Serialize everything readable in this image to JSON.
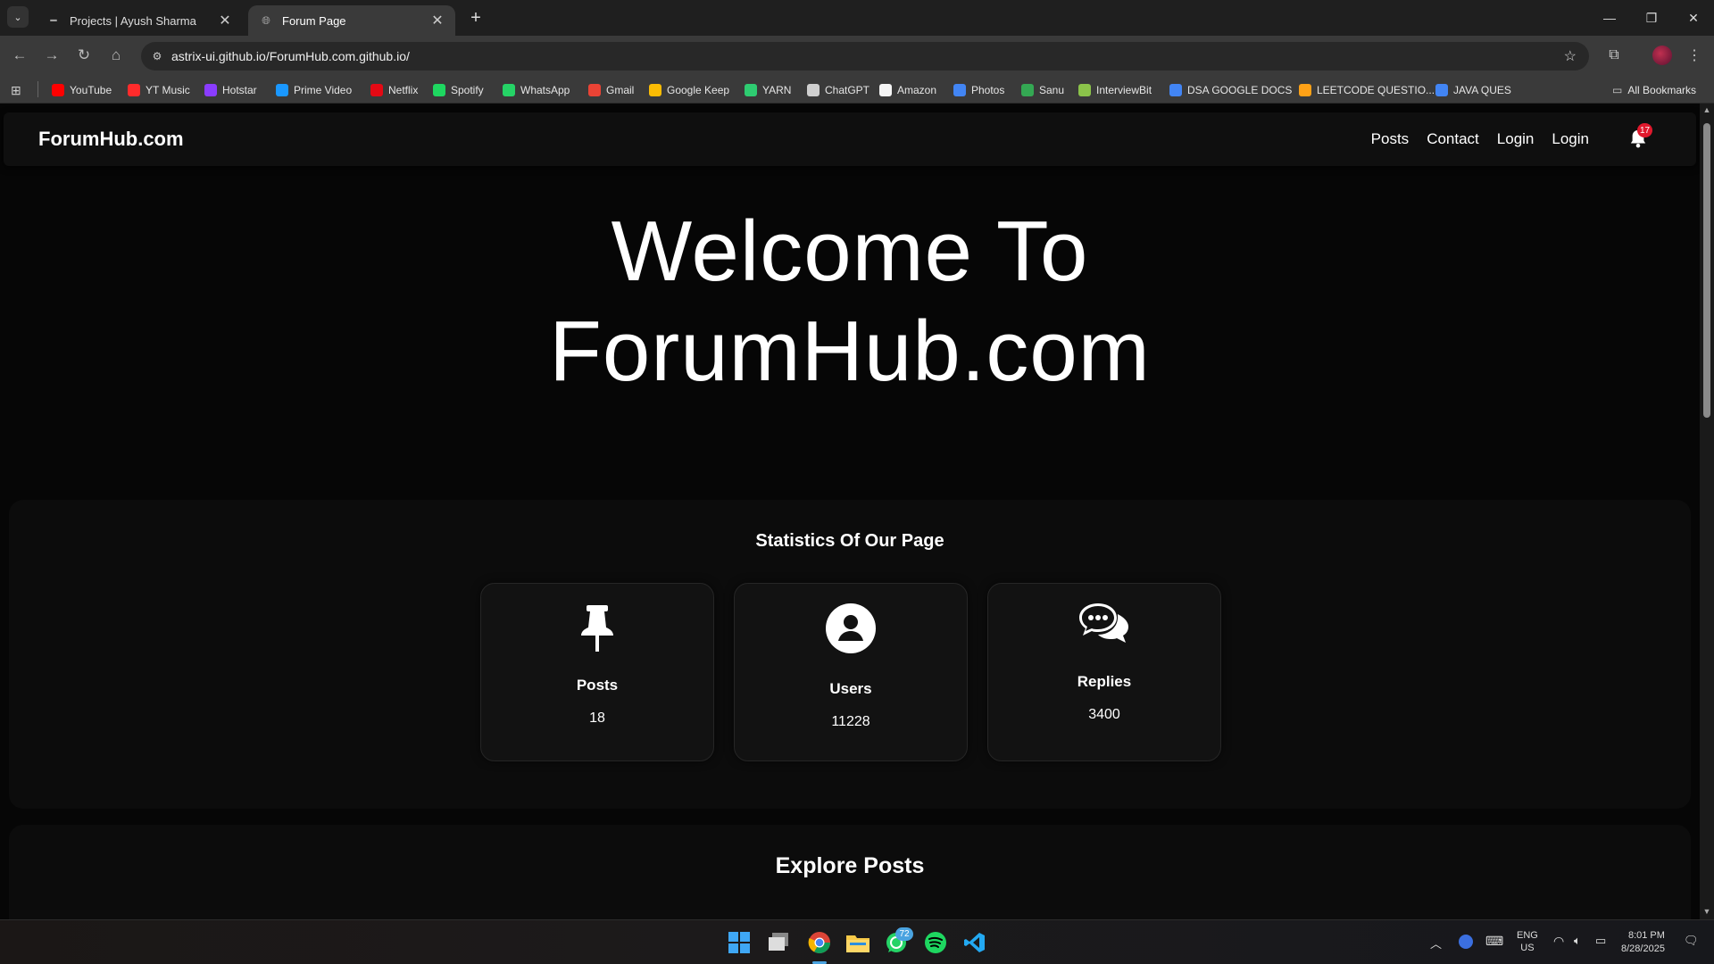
{
  "browser": {
    "tabs": [
      {
        "label": "Projects | Ayush Sharma",
        "active": false
      },
      {
        "label": "Forum Page",
        "active": true
      }
    ],
    "url": "astrix-ui.github.io/ForumHub.com.github.io/",
    "bookmarks": [
      {
        "label": "YouTube",
        "color": "#ff0000"
      },
      {
        "label": "YT Music",
        "color": "#ff2b2b"
      },
      {
        "label": "Hotstar",
        "color": "#8a3cff"
      },
      {
        "label": "Prime Video",
        "color": "#1a98ff"
      },
      {
        "label": "Netflix",
        "color": "#e50914"
      },
      {
        "label": "Spotify",
        "color": "#1ed760"
      },
      {
        "label": "WhatsApp",
        "color": "#25d366"
      },
      {
        "label": "Gmail",
        "color": "#ea4335"
      },
      {
        "label": "Google Keep",
        "color": "#fbbc04"
      },
      {
        "label": "YARN",
        "color": "#2ecc71"
      },
      {
        "label": "ChatGPT",
        "color": "#cfcfcf"
      },
      {
        "label": "Amazon",
        "color": "#f5f5f5"
      },
      {
        "label": "Photos",
        "color": "#4285f4"
      },
      {
        "label": "Sanu",
        "color": "#34a853"
      },
      {
        "label": "InterviewBit",
        "color": "#8bc34a"
      },
      {
        "label": "DSA GOOGLE DOCS",
        "color": "#4285f4"
      },
      {
        "label": "LEETCODE QUESTIO...",
        "color": "#ffa116"
      },
      {
        "label": "JAVA QUES",
        "color": "#4285f4"
      }
    ],
    "all_bookmarks": "All Bookmarks"
  },
  "site": {
    "brand": "ForumHub.com",
    "nav": [
      "Posts",
      "Contact",
      "Login",
      "Login"
    ],
    "notification_count": "17",
    "hero_line1": "Welcome To",
    "hero_line2": "ForumHub.com",
    "stats_title": "Statistics Of Our Page",
    "stats": [
      {
        "icon": "pushpin-icon",
        "label": "Posts",
        "value": "18"
      },
      {
        "icon": "user-circle-icon",
        "label": "Users",
        "value": "11228"
      },
      {
        "icon": "comments-icon",
        "label": "Replies",
        "value": "3400"
      }
    ],
    "explore_title": "Explore Posts"
  },
  "taskbar": {
    "whatsapp_badge": "72",
    "lang": "ENG",
    "region": "US",
    "time": "8:01 PM",
    "date": "8/28/2025"
  }
}
